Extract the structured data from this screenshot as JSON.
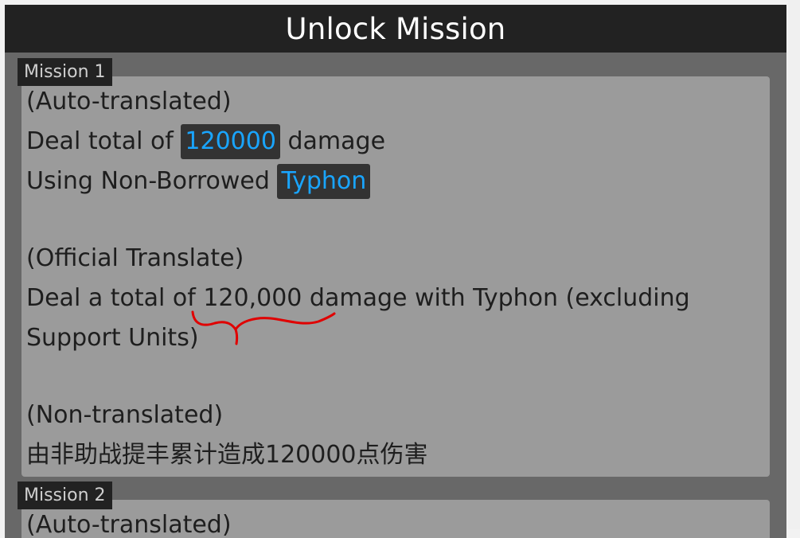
{
  "window": {
    "title": "Unlock Mission"
  },
  "missions": [
    {
      "tab_label": "Mission 1",
      "auto_header": "(Auto-translated)",
      "auto_line1_prefix": "Deal total of",
      "auto_line1_value": "120000",
      "auto_line1_suffix": "damage",
      "auto_line2_prefix": "Using Non-Borrowed",
      "auto_line2_value": "Typhon",
      "official_header": "(Official Translate)",
      "official_text": "Deal a total of 120,000 damage with Typhon (excluding Support Units)",
      "non_header": "(Non-translated)",
      "non_text": "由非助战提丰累计造成120000点伤害"
    },
    {
      "tab_label": "Mission 2",
      "auto_header": "(Auto-translated)"
    }
  ],
  "colors": {
    "highlight_text": "#19a5ff",
    "highlight_bg": "#333333",
    "annotation": "#e00000"
  }
}
